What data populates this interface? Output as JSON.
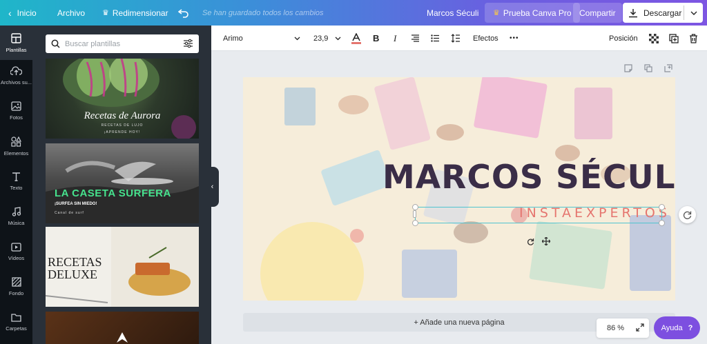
{
  "topbar": {
    "home": "Inicio",
    "file": "Archivo",
    "resize": "Redimensionar",
    "saved_status": "Se han guardado todos los cambios",
    "doc_name": "Marcos Séculi",
    "pro": "Prueba Canva Pro",
    "share": "Compartir",
    "download": "Descargar"
  },
  "rail": {
    "items": [
      {
        "label": "Plantillas",
        "icon": "templates-icon"
      },
      {
        "label": "Archivos su...",
        "icon": "upload-icon"
      },
      {
        "label": "Fotos",
        "icon": "photos-icon"
      },
      {
        "label": "Elementos",
        "icon": "elements-icon"
      },
      {
        "label": "Texto",
        "icon": "text-icon"
      },
      {
        "label": "Música",
        "icon": "music-icon"
      },
      {
        "label": "Vídeos",
        "icon": "video-icon"
      },
      {
        "label": "Fondo",
        "icon": "background-icon"
      },
      {
        "label": "Carpetas",
        "icon": "folder-icon"
      }
    ]
  },
  "panel": {
    "search_placeholder": "Buscar plantillas",
    "templates": [
      {
        "title": "Recetas de Aurora",
        "subtitle": "RECETAS DE LUJO",
        "cta": "¡APRENDE HOY!"
      },
      {
        "title": "LA CASETA SURFERA",
        "subtitle": "¡SURFEA SIN MIEDO!",
        "cta": "Canal de surf"
      },
      {
        "title": "RECETAS DELUXE"
      },
      {
        "title": ""
      }
    ]
  },
  "toolbar": {
    "font": "Arimo",
    "font_size": "23,9",
    "effects": "Efectos",
    "more": "•••",
    "position": "Posición"
  },
  "canvas": {
    "headline": "MARCOS SÉCULI",
    "subline": "INSTAEXPERTOS",
    "add_page": "+ Añade una nueva página"
  },
  "zoom": "86 %",
  "help": "Ayuda",
  "help_mark": "?",
  "colors": {
    "accent": "#7d4fe0",
    "headline": "#3a2d47",
    "subline": "#e5756f",
    "selection": "#4ec3cf"
  }
}
